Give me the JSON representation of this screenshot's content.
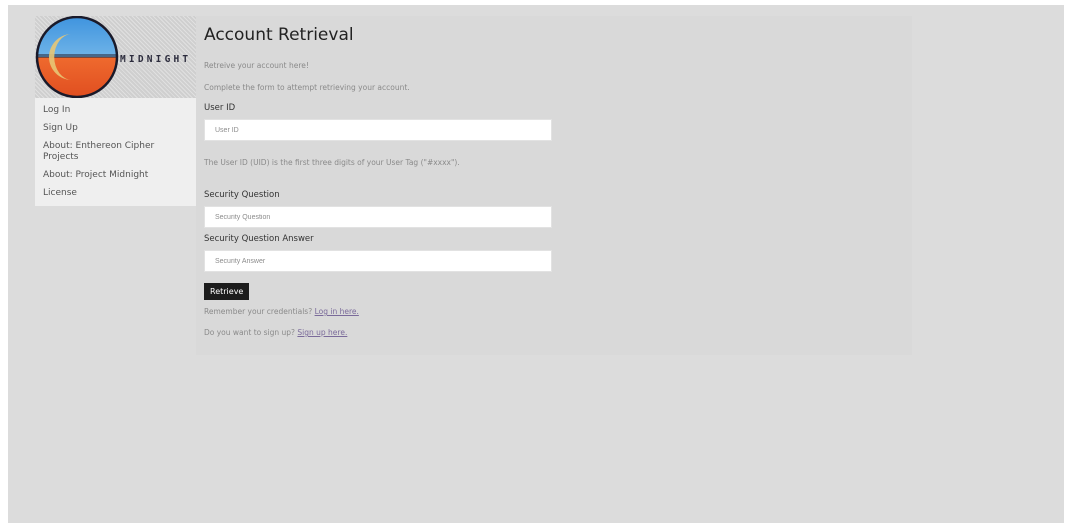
{
  "logo": {
    "text": "MIDNIGHT"
  },
  "sidebar": {
    "items": [
      {
        "label": "Log In"
      },
      {
        "label": "Sign Up"
      },
      {
        "label": "About: Enthereon Cipher Projects"
      },
      {
        "label": "About: Project Midnight"
      },
      {
        "label": "License"
      }
    ]
  },
  "main": {
    "title": "Account Retrieval",
    "intro": "Retreive your account here!",
    "instructions": "Complete the form to attempt retrieving your account.",
    "user_id": {
      "label": "User ID",
      "placeholder": "User ID",
      "help": "The User ID (UID) is the first three digits of your User Tag (\"#xxxx\")."
    },
    "security_question": {
      "label": "Security Question",
      "placeholder": "Security Question"
    },
    "security_answer": {
      "label": "Security Question Answer",
      "placeholder": "Security Answer"
    },
    "retrieve_button": "Retrieve",
    "remember": {
      "text": "Remember your credentials? ",
      "link": "Log in here."
    },
    "signup": {
      "text": "Do you want to sign up? ",
      "link": "Sign up here."
    }
  },
  "colors": {
    "background": "#dcdcdc",
    "sidebar": "#efefef",
    "button": "#1c1c1c",
    "link": "#7a6a9a",
    "logo_sky": "#4a9fe0",
    "logo_ground": "#e8602c",
    "logo_moon": "#e7c776"
  }
}
